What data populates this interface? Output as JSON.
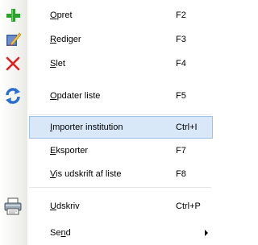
{
  "menu": {
    "items": [
      {
        "pre": "",
        "mn": "O",
        "post": "pret",
        "shortcut": "F2",
        "icon": "plus-icon"
      },
      {
        "pre": "",
        "mn": "R",
        "post": "ediger",
        "shortcut": "F3",
        "icon": "edit-pencil-icon"
      },
      {
        "pre": "",
        "mn": "S",
        "post": "let",
        "shortcut": "F4",
        "icon": "delete-x-icon"
      },
      {
        "pre": "",
        "mn": "O",
        "post": "pdater liste",
        "shortcut": "F5",
        "icon": "refresh-arrows-icon"
      },
      {
        "pre": "",
        "mn": "I",
        "post": "mporter institution",
        "shortcut": "Ctrl+I",
        "icon": ""
      },
      {
        "pre": "",
        "mn": "E",
        "post": "ksporter",
        "shortcut": "F7",
        "icon": ""
      },
      {
        "pre": "",
        "mn": "V",
        "post": "is udskrift af liste",
        "shortcut": "F8",
        "icon": ""
      },
      {
        "pre": "",
        "mn": "U",
        "post": "dskriv",
        "shortcut": "Ctrl+P",
        "icon": "printer-icon"
      },
      {
        "pre": "Se",
        "mn": "n",
        "post": "d",
        "shortcut": "",
        "icon": "submenu-arrow-icon"
      }
    ]
  },
  "colors": {
    "selected_bg": "#d8e8f8",
    "selected_border": "#9fc2e8",
    "plus": "#2ea02e",
    "delete": "#e02020",
    "refresh": "#2a6fd0"
  }
}
